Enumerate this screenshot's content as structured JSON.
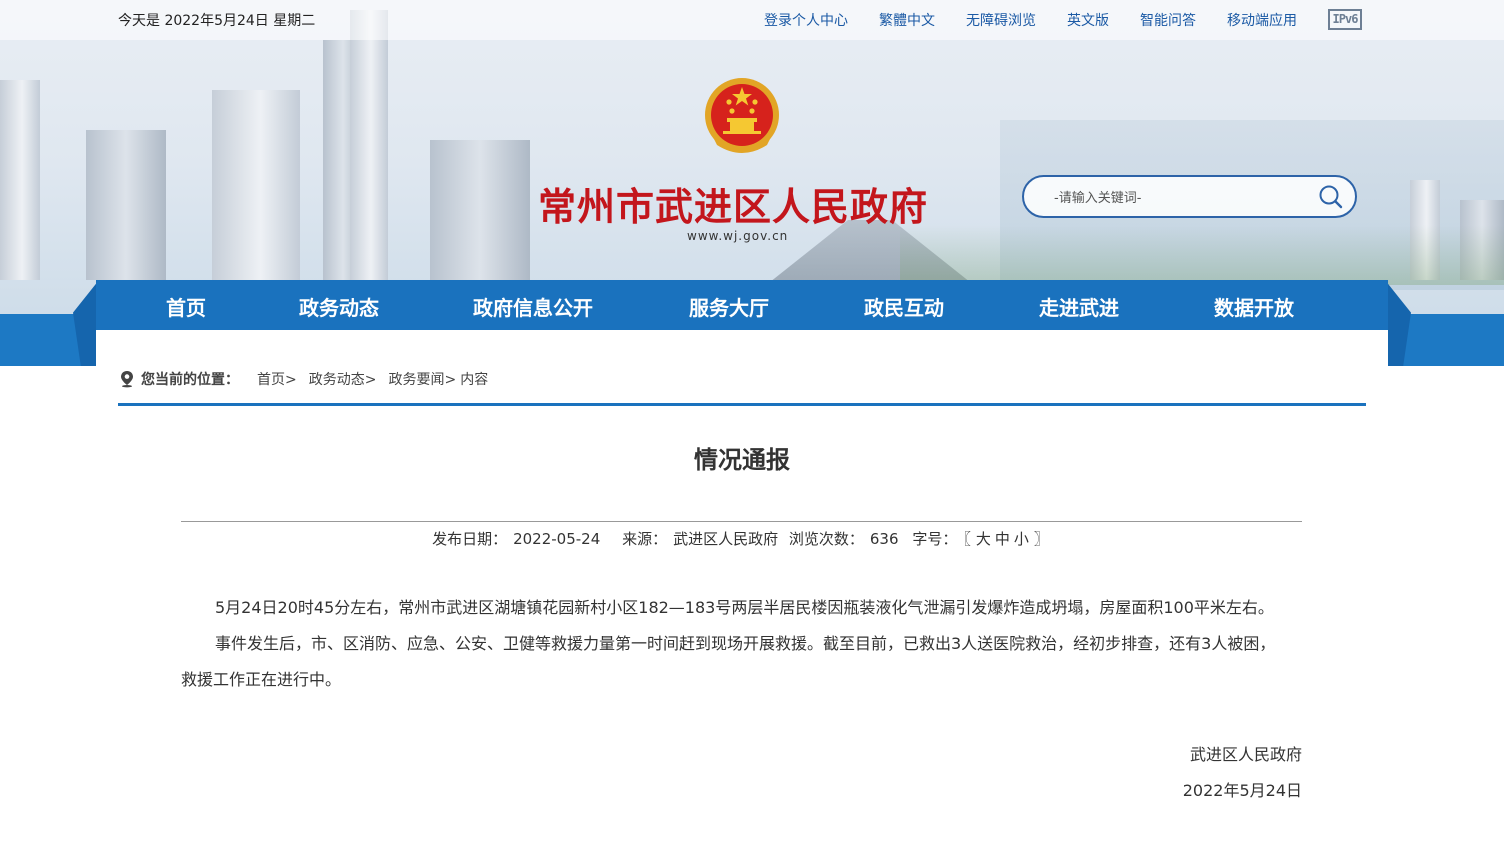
{
  "topbar": {
    "date": "今天是 2022年5月24日 星期二",
    "links": [
      "登录个人中心",
      "繁體中文",
      "无障碍浏览",
      "英文版",
      "智能问答",
      "移动端应用"
    ],
    "ipv6": "IPv6"
  },
  "header": {
    "title": "常州市武进区人民政府",
    "url": "www.wj.gov.cn",
    "emblem_icon": "national-emblem-icon"
  },
  "search": {
    "placeholder": "-请输入关键词-",
    "icon": "search-icon"
  },
  "nav": {
    "items": [
      "首页",
      "政务动态",
      "政府信息公开",
      "服务大厅",
      "政民互动",
      "走进武进",
      "数据开放"
    ]
  },
  "breadcrumb": {
    "label": "您当前的位置：",
    "items": [
      "首页>",
      "政务动态>",
      "政务要闻>"
    ],
    "current": "内容"
  },
  "article": {
    "title": "情况通报",
    "meta": {
      "date_label": "发布日期：",
      "date": "2022-05-24",
      "source_label": "来源：",
      "source": "武进区人民政府",
      "views_label": "浏览次数：",
      "views": "636",
      "size_label": "字号：",
      "size_open": "〖",
      "size_large": "大",
      "size_medium": "中",
      "size_small": "小",
      "size_close": "〗"
    },
    "paragraphs": [
      "5月24日20时45分左右，常州市武进区湖塘镇花园新村小区182—183号两层半居民楼因瓶装液化气泄漏引发爆炸造成坍塌，房屋面积100平米左右。",
      "事件发生后，市、区消防、应急、公安、卫健等救援力量第一时间赶到现场开展救援。截至目前，已救出3人送医院救治，经初步排查，还有3人被困，救援工作正在进行中。"
    ],
    "signature": "武进区人民政府",
    "sign_date": "2022年5月24日"
  },
  "colors": {
    "nav_blue": "#1a72be",
    "title_red": "#c3161c",
    "link_blue": "#1b5aa5"
  }
}
